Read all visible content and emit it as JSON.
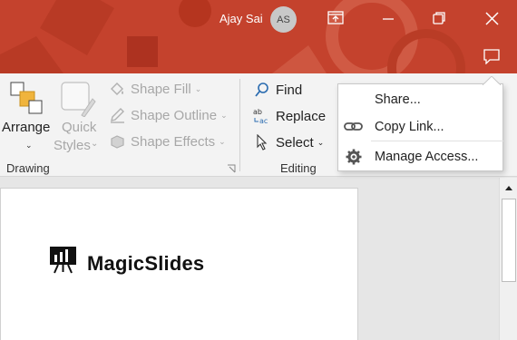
{
  "titlebar": {
    "user_name": "Ajay Sai",
    "avatar_initials": "AS",
    "accent_color": "#c4422d"
  },
  "ribbon": {
    "drawing": {
      "arrange_label": "Arrange",
      "quick_label_1": "Quick",
      "quick_label_2": "Styles",
      "shape_fill": "Shape Fill",
      "shape_outline": "Shape Outline",
      "shape_effects": "Shape Effects",
      "group_label": "Drawing"
    },
    "editing": {
      "find": "Find",
      "replace": "Replace",
      "select": "Select",
      "group_label": "Editing"
    }
  },
  "share_menu": {
    "items": [
      {
        "label": "Share...",
        "icon": "none"
      },
      {
        "label": "Copy Link...",
        "icon": "link-icon"
      },
      {
        "label": "Manage Access...",
        "icon": "gear-icon"
      }
    ]
  },
  "slide": {
    "logo_text": "MagicSlides"
  }
}
